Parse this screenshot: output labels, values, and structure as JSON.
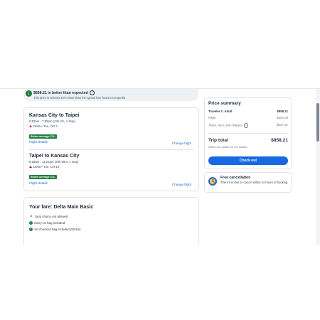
{
  "banner": {
    "headline": "$858.21 is better than expected",
    "subtext": "This price is at least 44% lower than the typical fare found on Expedia"
  },
  "flights": [
    {
      "route": "Kansas City to Taipei",
      "times": "6:53am - 7:55pm (24h 2m, 1 stop)",
      "airline_date": "Delta • Tue, Oct 7",
      "co2_badge": "Below average CO₂",
      "details_link": "Flight details",
      "change_link": "Change flight"
    },
    {
      "route": "Taipei to Kansas City",
      "times": "9:25am - 11:21pm (26h 56m, 1 stop)",
      "airline_date": "Delta • Tue, Oct 14",
      "co2_badge": "Below average CO₂",
      "details_link": "Flight details",
      "change_link": "Change flight"
    }
  ],
  "fare": {
    "title": "Your fare: Delta Main Basic",
    "features": [
      {
        "text": "Seat choice not allowed",
        "included": false
      },
      {
        "text": "Carry-on bag included",
        "included": true
      },
      {
        "text": "1st checked bag included (50 lbs)",
        "included": true
      }
    ]
  },
  "price_summary": {
    "title": "Price summary",
    "traveler_label": "Traveler 1: Adult",
    "traveler_amount": "$858.21",
    "flight_label": "Flight",
    "flight_amount": "$451.00",
    "taxes_label": "Taxes, fees, and charges",
    "taxes_amount": "$407.21",
    "total_label": "Trip total",
    "total_amount": "$858.21",
    "rates_note": "Rates are quoted in US dollars",
    "checkout_label": "Check out"
  },
  "cancellation": {
    "title": "Free cancellation",
    "description": "There's no fee to cancel within 24 hours of booking."
  },
  "colors": {
    "accent": "#1668e3",
    "success": "#227e3f",
    "alert": "#c8102e"
  }
}
